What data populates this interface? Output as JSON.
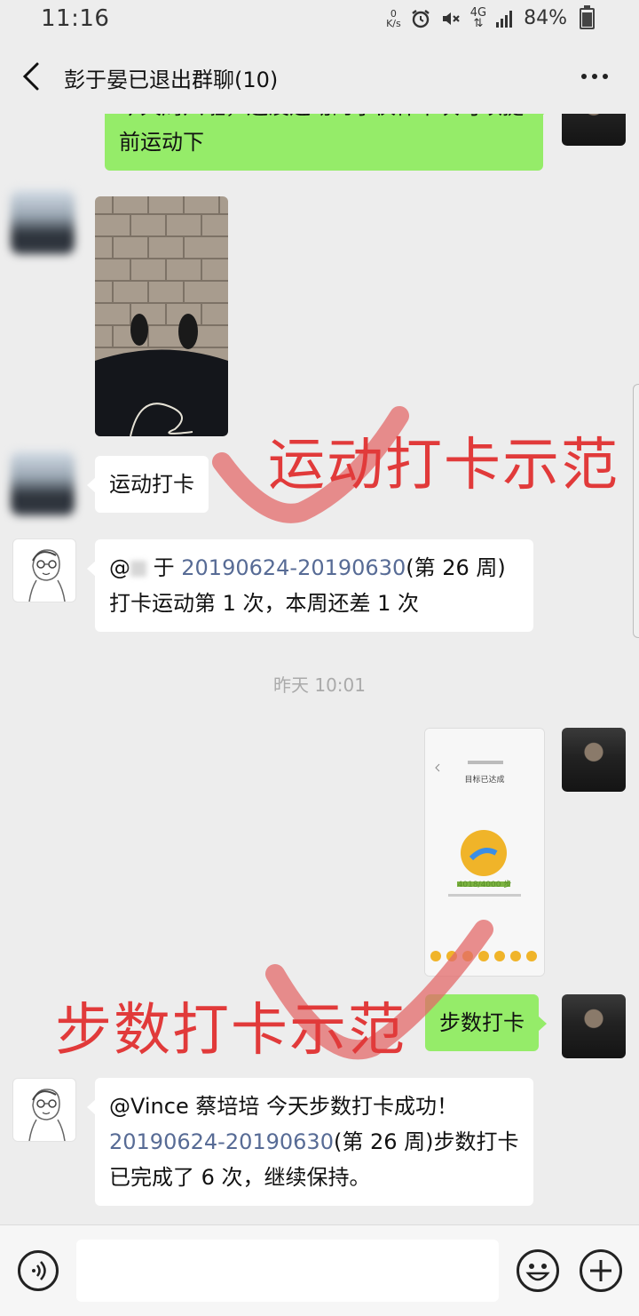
{
  "status": {
    "time": "11:16",
    "net_speed_top": "0",
    "net_speed_bottom": "K/s",
    "network": "4G",
    "battery": "84%"
  },
  "header": {
    "title": "彭于晏已退出群聊(10)"
  },
  "messages": [
    {
      "type": "text",
      "side": "right",
      "text": "今天周六啦，还没运动的小伙伴下次可以提前运动下"
    },
    {
      "type": "image",
      "side": "left",
      "description": "photo-feet-on-bricks"
    },
    {
      "type": "text",
      "side": "left",
      "text": "运动打卡"
    },
    {
      "type": "text",
      "side": "left",
      "parts": {
        "prefix": "@",
        "blur": "　",
        "mid": " 于 ",
        "link": "20190624-20190630",
        "suffix": "(第 26 周)打卡运动第 1 次，本周还差 1 次"
      }
    },
    {
      "type": "time",
      "text": "昨天 10:01"
    },
    {
      "type": "image",
      "side": "right",
      "description": "step-count-screenshot",
      "inner": {
        "title": "目标已达成",
        "steps": "4018/4000 步"
      }
    },
    {
      "type": "text",
      "side": "right",
      "text": "步数打卡"
    },
    {
      "type": "text",
      "side": "left",
      "parts": {
        "line1": "@Vince 蔡培培 今天步数打卡成功！",
        "link": "20190624-20190630",
        "suffix": "(第 26 周)步数打卡已完成了 6 次，继续保持。"
      }
    }
  ],
  "annotations": {
    "sport": "运动打卡示范",
    "steps": "步数打卡示范"
  },
  "input": {
    "placeholder": ""
  },
  "icons": {
    "back": "back-arrow-icon",
    "more": "more-dots-icon",
    "voice": "voice-icon",
    "emoji": "emoji-icon",
    "add": "plus-icon"
  },
  "colors": {
    "bubble_green": "#95ec69",
    "link": "#576b95",
    "annotation": "#e13a3a",
    "background": "#ededed"
  }
}
